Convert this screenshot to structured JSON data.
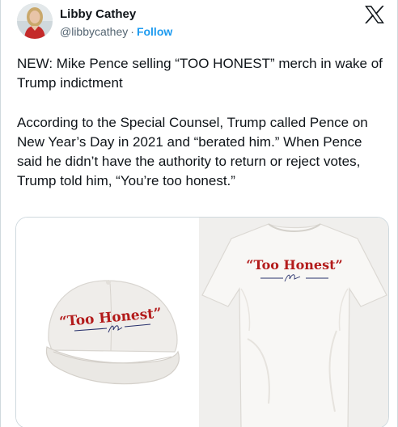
{
  "author": {
    "name": "Libby Cathey",
    "handle": "@libbycathey",
    "separator": "·",
    "follow_label": "Follow",
    "avatar_icon": "profile-photo"
  },
  "platform_icon": "x-logo-icon",
  "tweet": {
    "paragraph1": "NEW: Mike Pence selling “TOO HONEST” merch in wake of Trump indictment",
    "paragraph2": "According to the Special Counsel, Trump called Pence on New Year’s Day in 2021 and “berated him.” When Pence said he didn’t have the authority to return or reject votes, Trump told him, “You’re too honest.”"
  },
  "media": {
    "cap_slogan": "“Too Honest”",
    "shirt_slogan": "“Too Honest”",
    "colors": {
      "slogan_red": "#b31b1b",
      "underline_navy": "#27306b",
      "cap_white": "#efedea",
      "shirt_white": "#f2f1ee",
      "shirt_bg": "#f0efed"
    }
  }
}
